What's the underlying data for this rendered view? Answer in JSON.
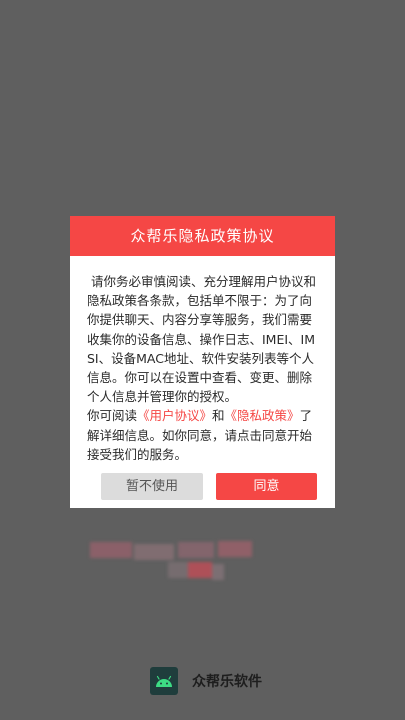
{
  "colors": {
    "accent": "#f54745",
    "overlay_background": "#5f5f5f",
    "link": "#f54745"
  },
  "dialog": {
    "title": "众帮乐隐私政策协议",
    "intro": "请你务必审慎阅读、充分理解用户协议和隐私政策各条款，包括单不限于：为了向你提供聊天、内容分享等服务，我们需要收集你的设备信息、操作日志、IMEI、IMSI、设备MAC地址、软件安装列表等个人信息。你可以在设置中查看、变更、删除个人信息并管理你的授权。",
    "read_prefix": "你可阅读",
    "user_agreement_link": "《用户协议》",
    "read_and": "和",
    "privacy_policy_link": "《隐私政策》",
    "read_suffix": "了解详细信息。如你同意，请点击同意开始接受我们的服务。",
    "decline_label": "暂不使用",
    "agree_label": "同意"
  },
  "footer": {
    "logo_icon": "android-icon",
    "app_name": "众帮乐软件"
  }
}
